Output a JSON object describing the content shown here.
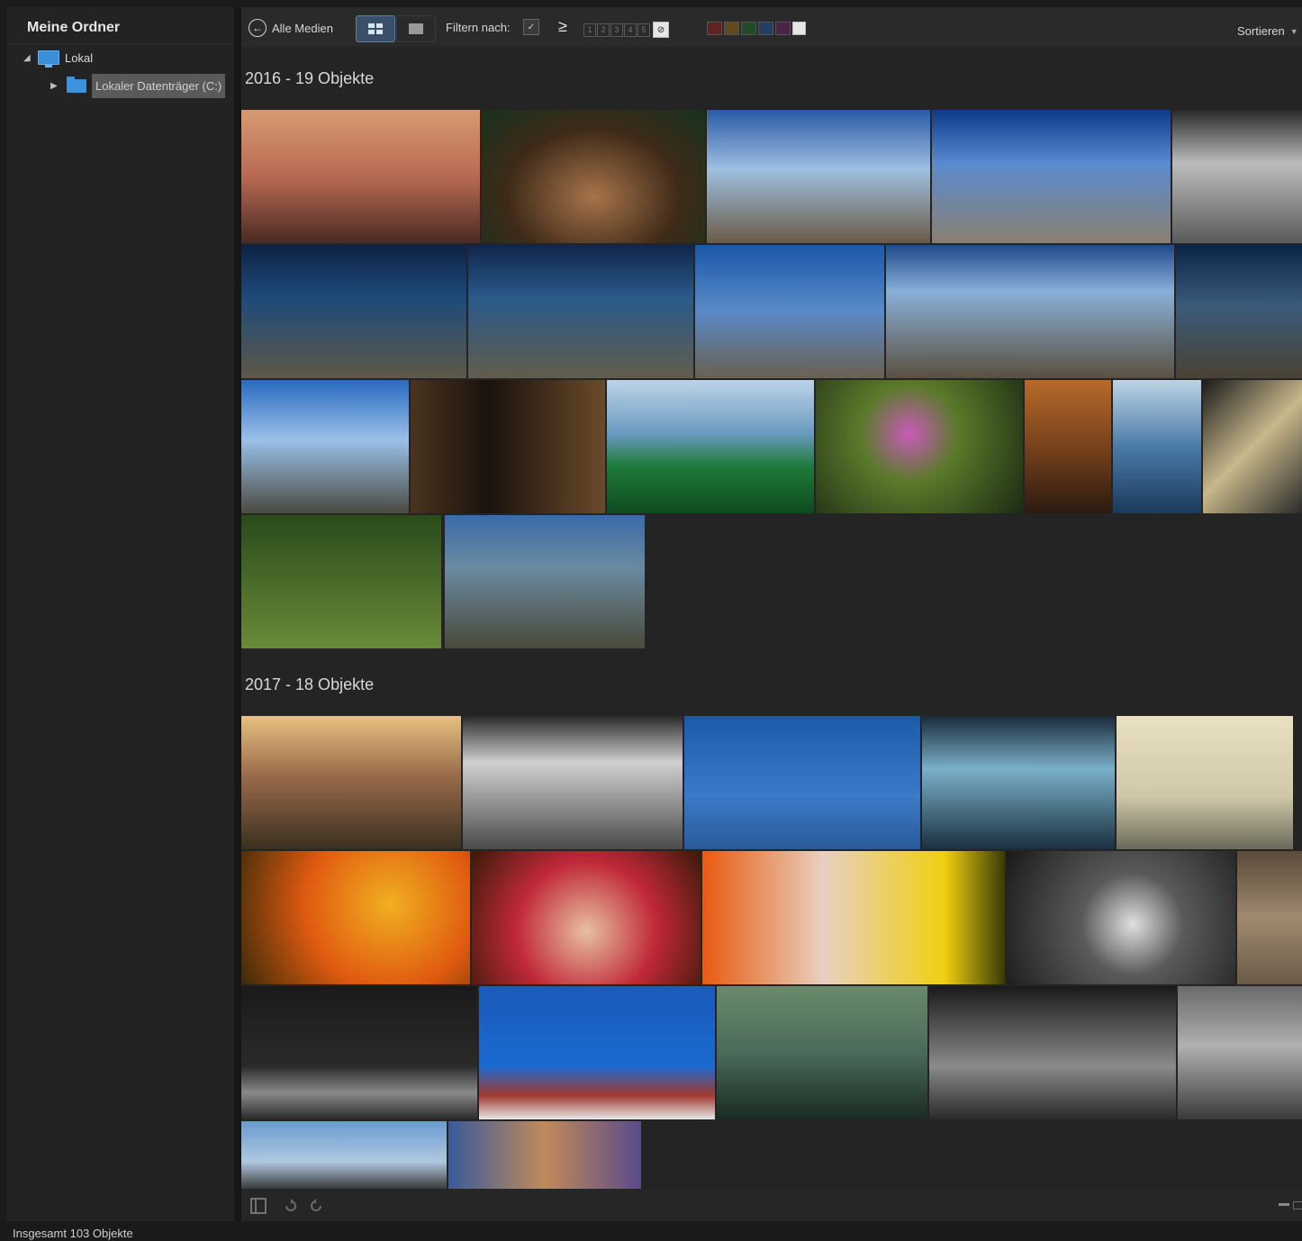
{
  "sidebar": {
    "title": "Meine Ordner",
    "root": {
      "label": "Lokal",
      "icon": "monitor-icon"
    },
    "child": {
      "label": "Lokaler Datenträger (C:)",
      "icon": "folder-icon"
    }
  },
  "toolbar": {
    "back_label": "Alle Medien",
    "filter_label": "Filtern nach:",
    "compare_symbol": "≥",
    "ratings": [
      "1",
      "2",
      "3",
      "4",
      "5"
    ],
    "sort_label": "Sortieren",
    "color_labels": [
      "#7a2a2a",
      "#7a5a1e",
      "#2a5a30",
      "#284c78",
      "#5a2a5a"
    ]
  },
  "groups": [
    {
      "title": "2016 - 19 Objekte"
    },
    {
      "title": "2017 - 18 Objekte"
    }
  ],
  "status": {
    "total": "Insgesamt 103 Objekte"
  }
}
